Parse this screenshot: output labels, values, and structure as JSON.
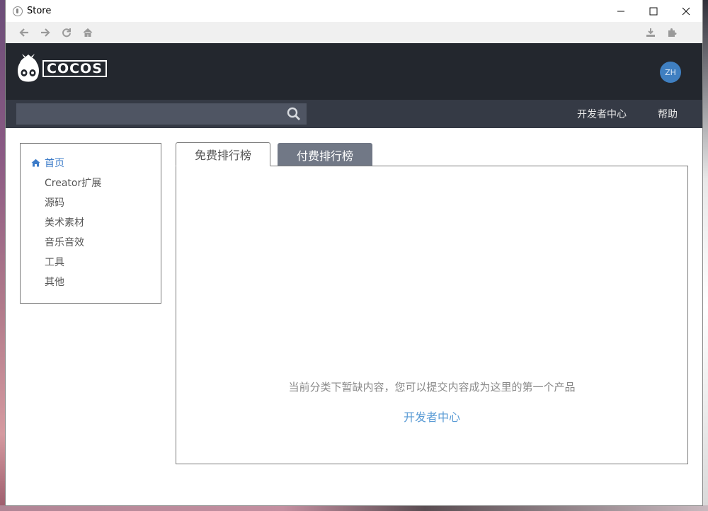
{
  "window": {
    "title": "Store",
    "controls": {
      "minimize": "—",
      "maximize": "☐",
      "close": "✕"
    }
  },
  "toolbar": {
    "icons": [
      "back-icon",
      "forward-icon",
      "refresh-icon",
      "home-icon",
      "download-icon",
      "extension-icon"
    ]
  },
  "header": {
    "logo_text": "COCOS",
    "avatar_initials": "ZH",
    "colors": {
      "header_bg": "#23272e",
      "avatar_bg": "#3f7fc1"
    }
  },
  "nav": {
    "search_placeholder": "",
    "links": [
      "开发者中心",
      "帮助"
    ]
  },
  "sidebar": {
    "items": [
      {
        "label": "首页",
        "active": true
      },
      {
        "label": "Creator扩展",
        "active": false
      },
      {
        "label": "源码",
        "active": false
      },
      {
        "label": "美术素材",
        "active": false
      },
      {
        "label": "音乐音效",
        "active": false
      },
      {
        "label": "工具",
        "active": false
      },
      {
        "label": "其他",
        "active": false
      }
    ]
  },
  "main": {
    "tabs": [
      {
        "label": "免费排行榜",
        "active": true
      },
      {
        "label": "付费排行榜",
        "active": false
      }
    ],
    "empty_message": "当前分类下暂缺内容，您可以提交内容成为这里的第一个产品",
    "developer_link": "开发者中心",
    "colors": {
      "link": "#5a9bd5",
      "active_sidebar": "#3d7cc9",
      "inactive_tab_bg": "#717886"
    }
  }
}
